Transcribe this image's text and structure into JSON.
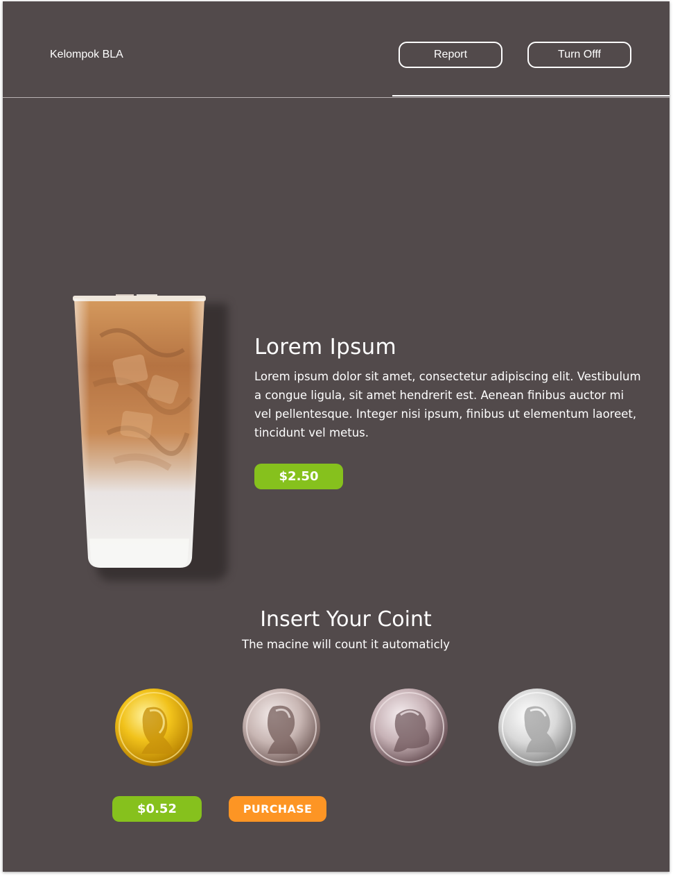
{
  "header": {
    "brand": "Kelompok BLA",
    "report_label": "Report",
    "turn_off_label": "Turn Offf"
  },
  "product": {
    "image_icon": "iced-coffee-glass",
    "title": "Lorem Ipsum",
    "description": "Lorem ipsum dolor sit amet, consectetur adipiscing elit. Vestibulum a congue ligula, sit amet hendrerit est. Aenean finibus auctor mi vel pellentesque. Integer nisi ipsum, finibus ut elementum laoreet, tincidunt vel metus.",
    "price": "$2.50"
  },
  "coins": {
    "title": "Insert Your Coint",
    "subtitle": "The macine will count it automaticly",
    "items": [
      {
        "icon": "penny-coin-icon"
      },
      {
        "icon": "nickel-coin-icon"
      },
      {
        "icon": "dime-coin-icon"
      },
      {
        "icon": "quarter-coin-icon"
      }
    ],
    "total": "$0.52",
    "purchase_label": "PURCHASE"
  },
  "colors": {
    "background": "#524a4b",
    "accent_green": "#86c11d",
    "accent_orange": "#fd9524",
    "text": "#ffffff"
  }
}
